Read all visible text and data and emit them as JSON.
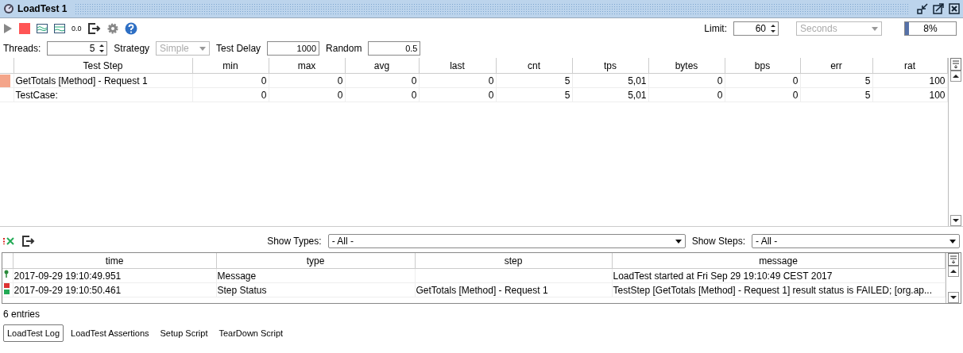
{
  "window": {
    "title": "LoadTest 1"
  },
  "toolbar": {
    "limit_label": "Limit:",
    "limit_value": "60",
    "limit_unit": {
      "value": "Seconds",
      "disabled": true
    },
    "progress": {
      "level": 0.08,
      "reading": "8%"
    },
    "number_format_button": "0.0"
  },
  "settings": [
    {
      "kind": "spinner",
      "label": "Threads:",
      "value": "5"
    },
    {
      "kind": "select",
      "label": "Strategy",
      "value": "Simple",
      "disabled": true
    },
    {
      "kind": "text",
      "label": "Test Delay",
      "value": "1000"
    },
    {
      "kind": "text",
      "label": "Random",
      "value": "0.5"
    }
  ],
  "stats_table": {
    "columns": [
      "Test Step",
      "min",
      "max",
      "avg",
      "last",
      "cnt",
      "tps",
      "bytes",
      "bps",
      "err",
      "rat"
    ],
    "rows": [
      {
        "color": "#f4a58a",
        "cells": [
          "GetTotals [Method] - Request 1",
          "0",
          "0",
          "0",
          "0",
          "5",
          "5,01",
          "0",
          "0",
          "5",
          "100"
        ]
      },
      {
        "cells": [
          "TestCase:",
          "0",
          "0",
          "0",
          "0",
          "5",
          "5,01",
          "0",
          "0",
          "5",
          "100"
        ]
      }
    ]
  },
  "log_filters": [
    {
      "label": "Show Types:",
      "value": "- All -"
    },
    {
      "label": "Show Steps:",
      "value": "- All -"
    }
  ],
  "log_table": {
    "columns": [
      "time",
      "type",
      "step",
      "message"
    ],
    "rows": [
      {
        "kind": "message",
        "cells": [
          "2017-09-29 19:10:49.951",
          "Message",
          "",
          "LoadTest started at Fri Sep 29 19:10:49 CEST 2017"
        ]
      },
      {
        "kind": "step_status",
        "cells": [
          "2017-09-29 19:10:50.461",
          "Step Status",
          "GetTotals [Method] - Request 1",
          "TestStep [GetTotals [Method] - Request 1] result status is FAILED; [org.ap..."
        ]
      }
    ]
  },
  "entry_count": "6 entries",
  "tabs": [
    {
      "label": "LoadTest Log",
      "selected": true
    },
    {
      "label": "LoadTest Assertions",
      "selected": false
    },
    {
      "label": "Setup Script",
      "selected": false
    },
    {
      "label": "TearDown Script",
      "selected": false
    }
  ]
}
